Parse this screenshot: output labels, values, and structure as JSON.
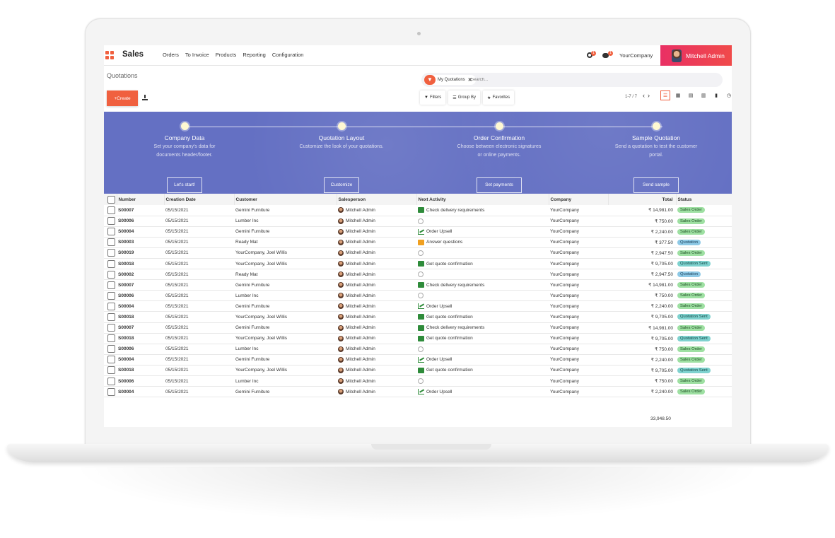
{
  "app": {
    "title": "Sales",
    "menu": [
      "Orders",
      "To Invoice",
      "Products",
      "Reporting",
      "Configuration"
    ],
    "activity_badge": "1",
    "chat_badge": "1",
    "company": "YourCompany",
    "user": "Mitchell Admin"
  },
  "control": {
    "breadcrumb": "Quotations",
    "facet": "My Quotations",
    "search_placeholder": "Search...",
    "create_label": "Create",
    "filters_label": "Filters",
    "groupby_label": "Group By",
    "favorites_label": "Favorites",
    "pager": "1-7 / 7"
  },
  "banner": {
    "steps": [
      {
        "title": "Company Data",
        "desc": "Set your company's data for documents header/footer.",
        "button": "Let's start!"
      },
      {
        "title": "Quotation Layout",
        "desc": "Customize the look of your quotations.",
        "button": "Customize"
      },
      {
        "title": "Order Confirmation",
        "desc": "Choose between electronic signatures or online payments.",
        "button": "Set payments"
      },
      {
        "title": "Sample Quotation",
        "desc": "Send a quotation to test the customer portal.",
        "button": "Send sample"
      }
    ]
  },
  "table": {
    "columns": [
      "Number",
      "Creation Date",
      "Customer",
      "Salesperson",
      "Next Activity",
      "Company",
      "Total",
      "Status"
    ],
    "rows": [
      {
        "number": "S00007",
        "date": "05/15/2021",
        "customer": "Gemini Furniture",
        "salesperson": "Mitchell Admin",
        "activity": "Check delivery requirements",
        "activity_icon": "check",
        "company": "YourCompany",
        "total": "₹ 14,981.00",
        "status": "Sales Order",
        "status_type": "so"
      },
      {
        "number": "S00006",
        "date": "05/15/2021",
        "customer": "Lumber Inc",
        "salesperson": "Mitchell Admin",
        "activity": "",
        "activity_icon": "clock",
        "company": "YourCompany",
        "total": "₹ 750.00",
        "status": "Sales Order",
        "status_type": "so"
      },
      {
        "number": "S00004",
        "date": "05/15/2021",
        "customer": "Gemini Furniture",
        "salesperson": "Mitchell Admin",
        "activity": "Order Upsell",
        "activity_icon": "upsell",
        "company": "YourCompany",
        "total": "₹ 2,240.00",
        "status": "Sales Order",
        "status_type": "so"
      },
      {
        "number": "S00003",
        "date": "05/15/2021",
        "customer": "Ready Mat",
        "salesperson": "Mitchell Admin",
        "activity": "Answer questions",
        "activity_icon": "mail",
        "company": "YourCompany",
        "total": "₹ 377.50",
        "status": "Quotation",
        "status_type": "q"
      },
      {
        "number": "S00019",
        "date": "05/15/2021",
        "customer": "YourCompany, Joel Willis",
        "salesperson": "Mitchell Admin",
        "activity": "",
        "activity_icon": "clock",
        "company": "YourCompany",
        "total": "₹ 2,947.50",
        "status": "Sales Order",
        "status_type": "so"
      },
      {
        "number": "S00018",
        "date": "05/15/2021",
        "customer": "YourCompany, Joel Willis",
        "salesperson": "Mitchell Admin",
        "activity": "Get quote confirmation",
        "activity_icon": "check",
        "company": "YourCompany",
        "total": "₹ 9,705.00",
        "status": "Quotation Sent",
        "status_type": "qs"
      },
      {
        "number": "S00002",
        "date": "05/15/2021",
        "customer": "Ready Mat",
        "salesperson": "Mitchell Admin",
        "activity": "",
        "activity_icon": "clock",
        "company": "YourCompany",
        "total": "₹ 2,947.50",
        "status": "Quotation",
        "status_type": "q"
      },
      {
        "number": "S00007",
        "date": "05/15/2021",
        "customer": "Gemini Furniture",
        "salesperson": "Mitchell Admin",
        "activity": "Check delivery requirements",
        "activity_icon": "check",
        "company": "YourCompany",
        "total": "₹ 14,981.00",
        "status": "Sales Order",
        "status_type": "so"
      },
      {
        "number": "S00006",
        "date": "05/15/2021",
        "customer": "Lumber Inc",
        "salesperson": "Mitchell Admin",
        "activity": "",
        "activity_icon": "clock",
        "company": "YourCompany",
        "total": "₹ 750.00",
        "status": "Sales Order",
        "status_type": "so"
      },
      {
        "number": "S00004",
        "date": "05/15/2021",
        "customer": "Gemini Furniture",
        "salesperson": "Mitchell Admin",
        "activity": "Order Upsell",
        "activity_icon": "upsell",
        "company": "YourCompany",
        "total": "₹ 2,240.00",
        "status": "Sales Order",
        "status_type": "so"
      },
      {
        "number": "S00018",
        "date": "05/15/2021",
        "customer": "YourCompany, Joel Willis",
        "salesperson": "Mitchell Admin",
        "activity": "Get quote confirmation",
        "activity_icon": "check",
        "company": "YourCompany",
        "total": "₹ 9,705.00",
        "status": "Quotation Sent",
        "status_type": "qs"
      },
      {
        "number": "S00007",
        "date": "05/15/2021",
        "customer": "Gemini Furniture",
        "salesperson": "Mitchell Admin",
        "activity": "Check delivery requirements",
        "activity_icon": "check",
        "company": "YourCompany",
        "total": "₹ 14,981.00",
        "status": "Sales Order",
        "status_type": "so"
      },
      {
        "number": "S00018",
        "date": "05/15/2021",
        "customer": "YourCompany, Joel Willis",
        "salesperson": "Mitchell Admin",
        "activity": "Get quote confirmation",
        "activity_icon": "check",
        "company": "YourCompany",
        "total": "₹ 9,705.00",
        "status": "Quotation Sent",
        "status_type": "qs"
      },
      {
        "number": "S00006",
        "date": "05/15/2021",
        "customer": "Lumber Inc",
        "salesperson": "Mitchell Admin",
        "activity": "",
        "activity_icon": "clock",
        "company": "YourCompany",
        "total": "₹ 750.00",
        "status": "Sales Order",
        "status_type": "so"
      },
      {
        "number": "S00004",
        "date": "05/15/2021",
        "customer": "Gemini Furniture",
        "salesperson": "Mitchell Admin",
        "activity": "Order Upsell",
        "activity_icon": "upsell",
        "company": "YourCompany",
        "total": "₹ 2,240.00",
        "status": "Sales Order",
        "status_type": "so"
      },
      {
        "number": "S00018",
        "date": "05/15/2021",
        "customer": "YourCompany, Joel Willis",
        "salesperson": "Mitchell Admin",
        "activity": "Get quote confirmation",
        "activity_icon": "check",
        "company": "YourCompany",
        "total": "₹ 9,705.00",
        "status": "Quotation Sent",
        "status_type": "qs"
      },
      {
        "number": "S00006",
        "date": "05/15/2021",
        "customer": "Lumber Inc",
        "salesperson": "Mitchell Admin",
        "activity": "",
        "activity_icon": "clock",
        "company": "YourCompany",
        "total": "₹ 750.00",
        "status": "Sales Order",
        "status_type": "so"
      },
      {
        "number": "S00004",
        "date": "05/15/2021",
        "customer": "Gemini Furniture",
        "salesperson": "Mitchell Admin",
        "activity": "Order Upsell",
        "activity_icon": "upsell",
        "company": "YourCompany",
        "total": "₹ 2,240.00",
        "status": "Sales Order",
        "status_type": "so"
      }
    ],
    "footer_total": "33,948.50"
  },
  "colors": {
    "accent": "#f0603f",
    "banner": "#6470c3",
    "user_gradient": "#e93064"
  }
}
